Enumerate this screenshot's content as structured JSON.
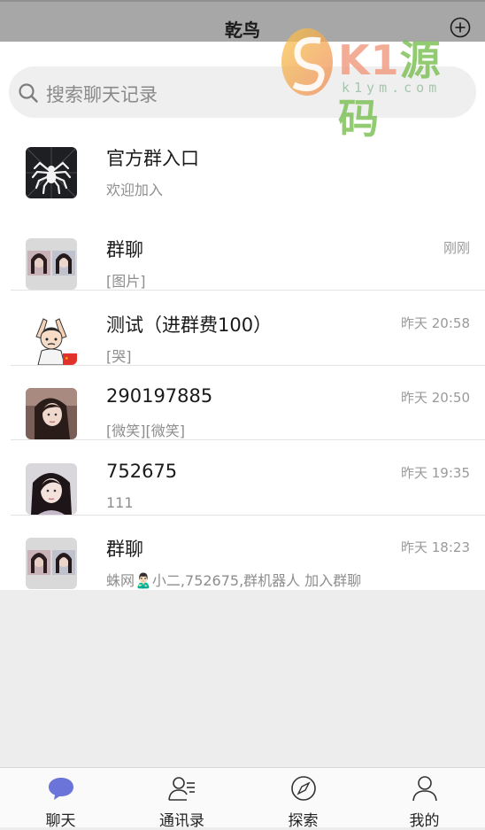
{
  "header": {
    "title": "乾鸟"
  },
  "watermark": {
    "brand_k": "K1",
    "brand_cn": "源码",
    "url": "k1ym.com"
  },
  "search": {
    "placeholder": "搜索聊天记录"
  },
  "chats": [
    {
      "name": "官方群入口",
      "message": "欢迎加入",
      "time": "",
      "avatar": "spider-logo"
    },
    {
      "name": "群聊",
      "message": "[图片]",
      "time": "刚刚",
      "avatar": "group-photos"
    },
    {
      "name": "测试（进群费100）",
      "message": "[哭]",
      "time": "昨天 20:58",
      "avatar": "cartoon-boy"
    },
    {
      "name": "290197885",
      "message": "[微笑][微笑]",
      "time": "昨天 20:50",
      "avatar": "photo-girl-1"
    },
    {
      "name": "752675",
      "message": "111",
      "time": "昨天 19:35",
      "avatar": "photo-girl-2"
    },
    {
      "name": "群聊",
      "message": "蛛网🙎🏻‍♂️小二,752675,群机器人 加入群聊",
      "time": "昨天 18:23",
      "avatar": "group-photos"
    }
  ],
  "tabs": [
    {
      "label": "聊天",
      "icon": "chat-icon",
      "active": true
    },
    {
      "label": "通讯录",
      "icon": "contacts-icon",
      "active": false
    },
    {
      "label": "探索",
      "icon": "compass-icon",
      "active": false
    },
    {
      "label": "我的",
      "icon": "person-icon",
      "active": false
    }
  ],
  "colors": {
    "accent": "#6b74d9",
    "header_bg": "#a7a7a7",
    "page_bg": "#ededee"
  }
}
